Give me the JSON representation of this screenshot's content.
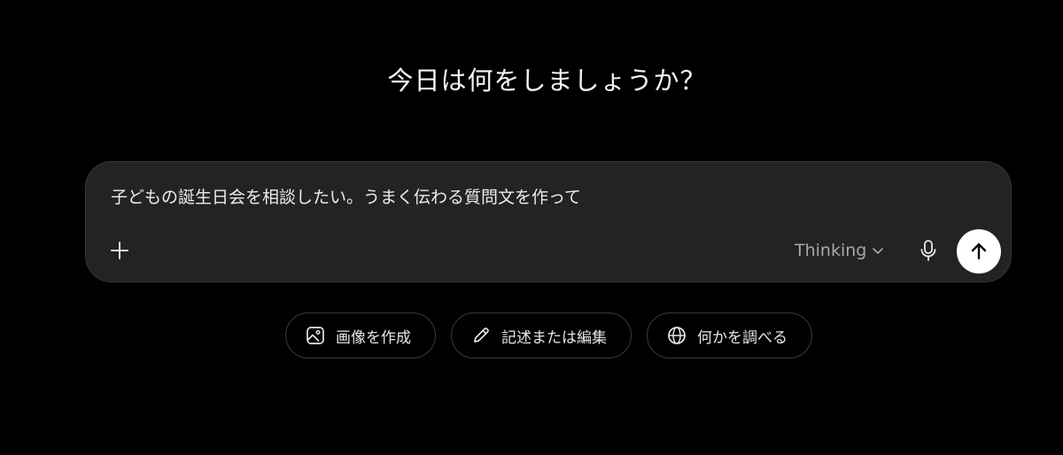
{
  "headline": "今日は何をしましょうか？",
  "composer": {
    "prompt_text": "子どもの誕生日会を相談したい。うまく伝わる質問文を作って",
    "model_label": "Thinking",
    "add_icon": "plus-icon",
    "model_icon": "chevron-down-icon",
    "mic_icon": "microphone-icon",
    "send_icon": "arrow-up-icon"
  },
  "suggestions": [
    {
      "label": "画像を作成",
      "icon": "image-icon"
    },
    {
      "label": "記述または編集",
      "icon": "pencil-icon"
    },
    {
      "label": "何かを調べる",
      "icon": "globe-icon"
    }
  ],
  "colors": {
    "background": "#000000",
    "composer_bg": "#232323",
    "send_button_bg": "#ffffff",
    "muted_text": "#a8a8a8"
  }
}
